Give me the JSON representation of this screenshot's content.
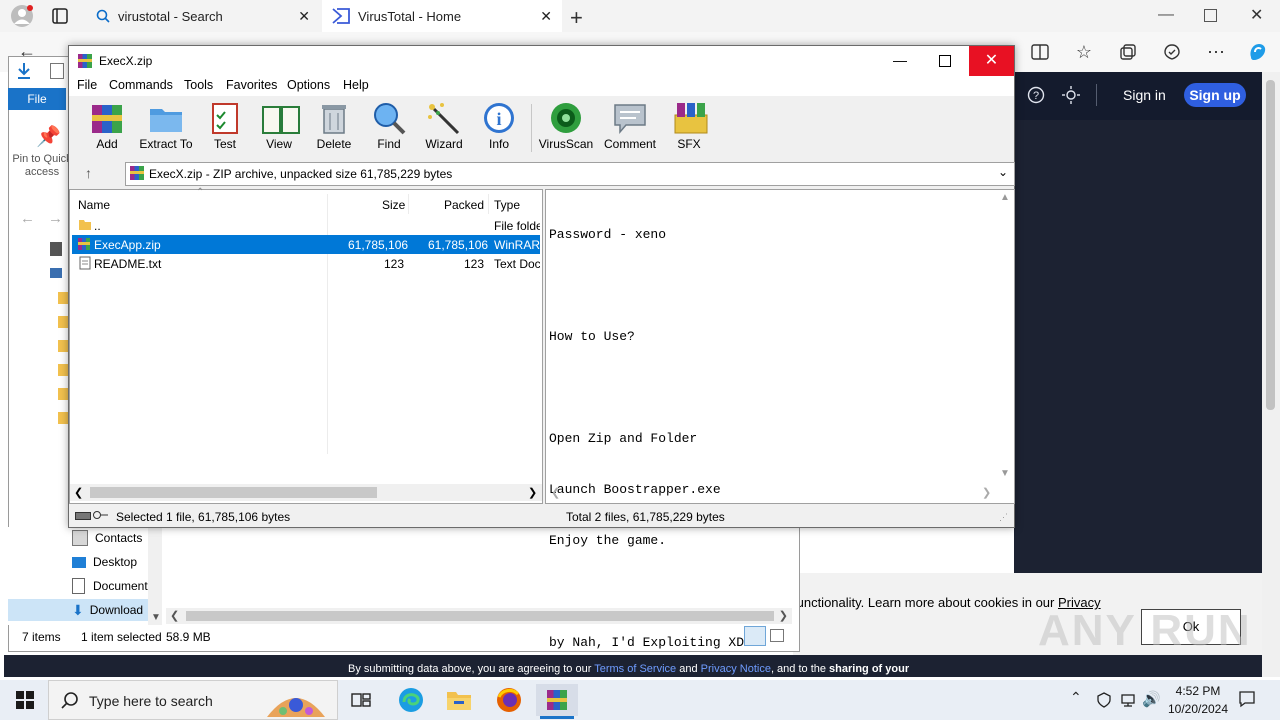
{
  "browser": {
    "tabs": [
      {
        "title": "virustotal - Search"
      },
      {
        "title": "VirusTotal - Home"
      }
    ]
  },
  "vt": {
    "sign_in": "Sign in",
    "sign_up": "Sign up",
    "cookie_text": "functionality. Learn more about cookies in our",
    "cookie_link": "Privacy",
    "ok_label": "Ok",
    "bottom_prefix": "By submitting data above, you are agreeing to our",
    "terms": "Terms of Service",
    "and": "and",
    "privacy_notice": "Privacy Notice",
    "bottom_suffix": ", and to the",
    "sharing": "sharing of your"
  },
  "explorer": {
    "file_tab": "File",
    "pin_label": "Pin to Quick access",
    "nav_items": [
      "Contacts",
      "Desktop",
      "Document",
      "Download"
    ],
    "status_items": "7 items",
    "status_selected": "1 item selected",
    "status_size": "58.9 MB"
  },
  "winrar": {
    "title": "ExecX.zip",
    "menu": [
      "File",
      "Commands",
      "Tools",
      "Favorites",
      "Options",
      "Help"
    ],
    "tools": [
      "Add",
      "Extract To",
      "Test",
      "View",
      "Delete",
      "Find",
      "Wizard",
      "Info",
      "VirusScan",
      "Comment",
      "SFX"
    ],
    "address": "ExecX.zip - ZIP archive, unpacked size 61,785,229 bytes",
    "columns": {
      "name": "Name",
      "size": "Size",
      "packed": "Packed",
      "type": "Type"
    },
    "files": [
      {
        "name": "..",
        "size": "",
        "packed": "",
        "type": "File folde"
      },
      {
        "name": "ExecApp.zip",
        "size": "61,785,106",
        "packed": "61,785,106",
        "type": "WinRAR"
      },
      {
        "name": "README.txt",
        "size": "123",
        "packed": "123",
        "type": "Text Doc"
      }
    ],
    "viewer_lines": [
      "Password - xeno",
      "",
      "How to Use?",
      "",
      "Open Zip and Folder",
      "Launch Boostrapper.exe",
      "Enjoy the game.",
      "",
      "by Nah, I'd Exploiting XD"
    ],
    "status_left": "Selected 1 file, 61,785,106 bytes",
    "status_right": "Total 2 files, 61,785,229 bytes"
  },
  "taskbar": {
    "search_placeholder": "Type here to search",
    "time": "4:52 PM",
    "date": "10/20/2024"
  },
  "watermark": "ANY RUN",
  "colors": {
    "selection": "#0078d7",
    "vt_dark": "#1c2232",
    "vt_signup": "#2f5fe0",
    "close_red": "#e81123"
  }
}
